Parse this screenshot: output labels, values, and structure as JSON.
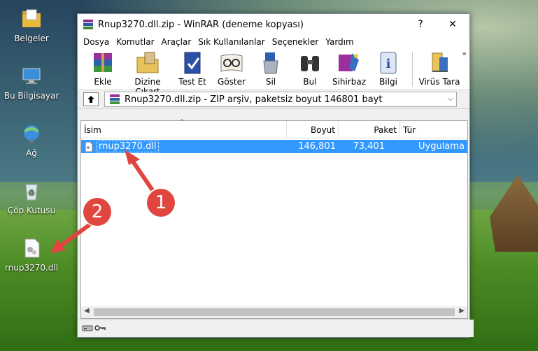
{
  "desktop": {
    "icons": [
      {
        "label": "Belgeler",
        "icon": "folder-icon"
      },
      {
        "label": "Bu Bilgisayar",
        "icon": "computer-icon"
      },
      {
        "label": "Ağ",
        "icon": "network-icon"
      },
      {
        "label": "Çöp Kutusu",
        "icon": "recycle-bin-icon"
      },
      {
        "label": "rnup3270.dll",
        "icon": "dll-file-icon"
      }
    ]
  },
  "window": {
    "title": "Rnup3270.dll.zip - WinRAR (deneme kopyası)",
    "help_label": "?",
    "close_label": "✕",
    "menu": [
      "Dosya",
      "Komutlar",
      "Araçlar",
      "Sık Kullanılanlar",
      "Seçenekler",
      "Yardım"
    ],
    "toolbar": [
      {
        "label": "Ekle",
        "icon": "add-archive-icon"
      },
      {
        "label": "Dizine Çıkart",
        "icon": "extract-to-icon"
      },
      {
        "label": "Test Et",
        "icon": "test-icon"
      },
      {
        "label": "Göster",
        "icon": "view-icon"
      },
      {
        "label": "Sil",
        "icon": "delete-icon"
      },
      {
        "label": "Bul",
        "icon": "find-icon"
      },
      {
        "label": "Sihirbaz",
        "icon": "wizard-icon"
      },
      {
        "label": "Bilgi",
        "icon": "info-icon"
      },
      {
        "label": "Virüs Tara",
        "icon": "virus-scan-icon"
      }
    ],
    "toolbar_more": "»",
    "address": "Rnup3270.dll.zip - ZIP arşiv, paketsiz boyut 146801 bayt",
    "columns": [
      "İsim",
      "Boyut",
      "Paket",
      "Tür"
    ],
    "files": [
      {
        "name": "rnup3270.dll",
        "size": "146,801",
        "packed": "73,401",
        "type": "Uygulama uza"
      }
    ]
  },
  "annotations": [
    "1",
    "2"
  ],
  "colors": {
    "selection": "#3399ff",
    "badge": "#e0463f"
  }
}
